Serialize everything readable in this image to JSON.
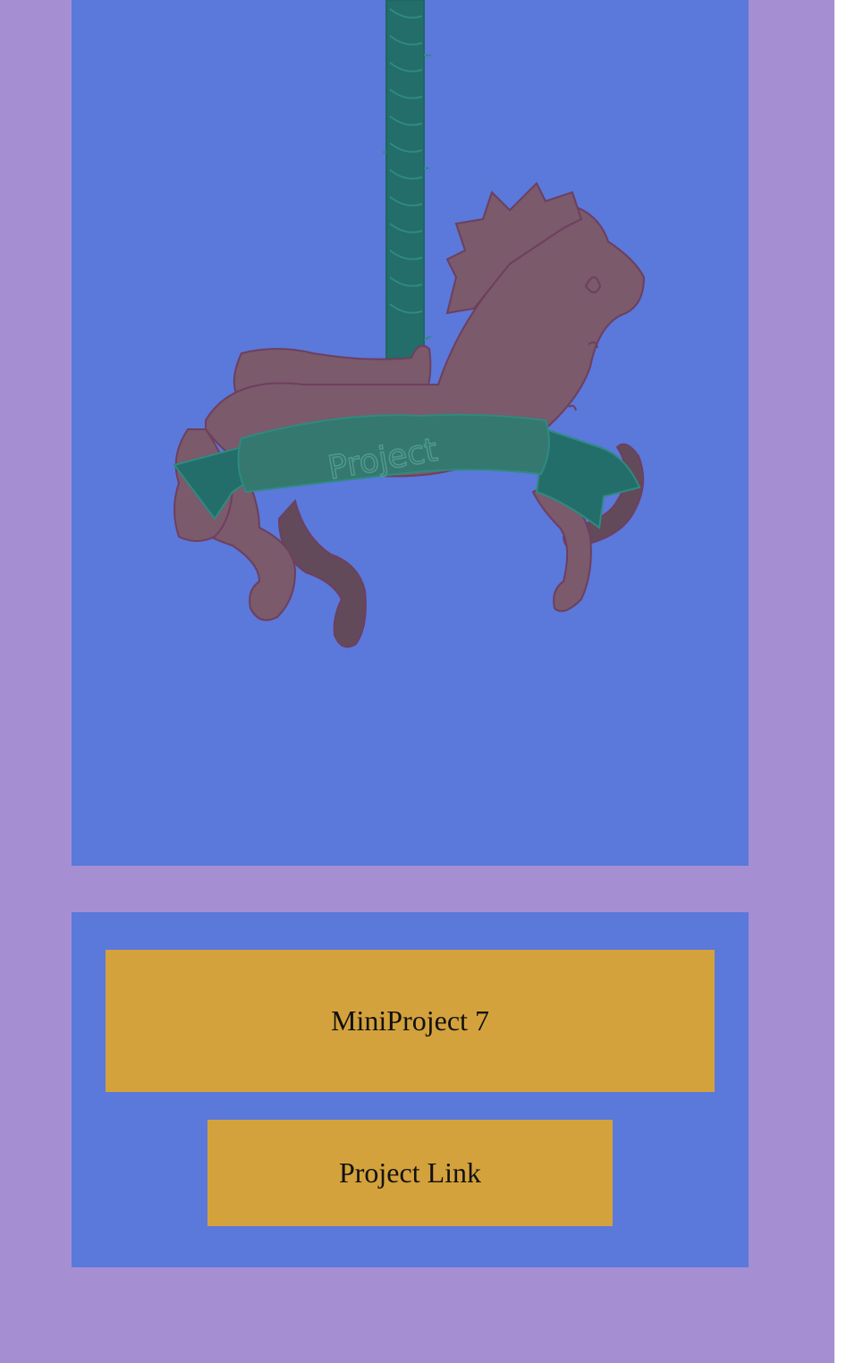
{
  "project": {
    "title": "MiniProject 7",
    "link_label": "Project Link"
  },
  "illustration": {
    "subject": "carousel-horse",
    "banner_text": "Project"
  },
  "colors": {
    "page_background": "#a68ed3",
    "panel_background": "#5b78db",
    "button_background": "#d4a23c",
    "horse_body": "#7a5a6b",
    "horse_dark": "#624a5b",
    "horse_outline": "#6e3f5e",
    "pole_green": "#236e6a",
    "banner_green": "#2e7d72"
  }
}
